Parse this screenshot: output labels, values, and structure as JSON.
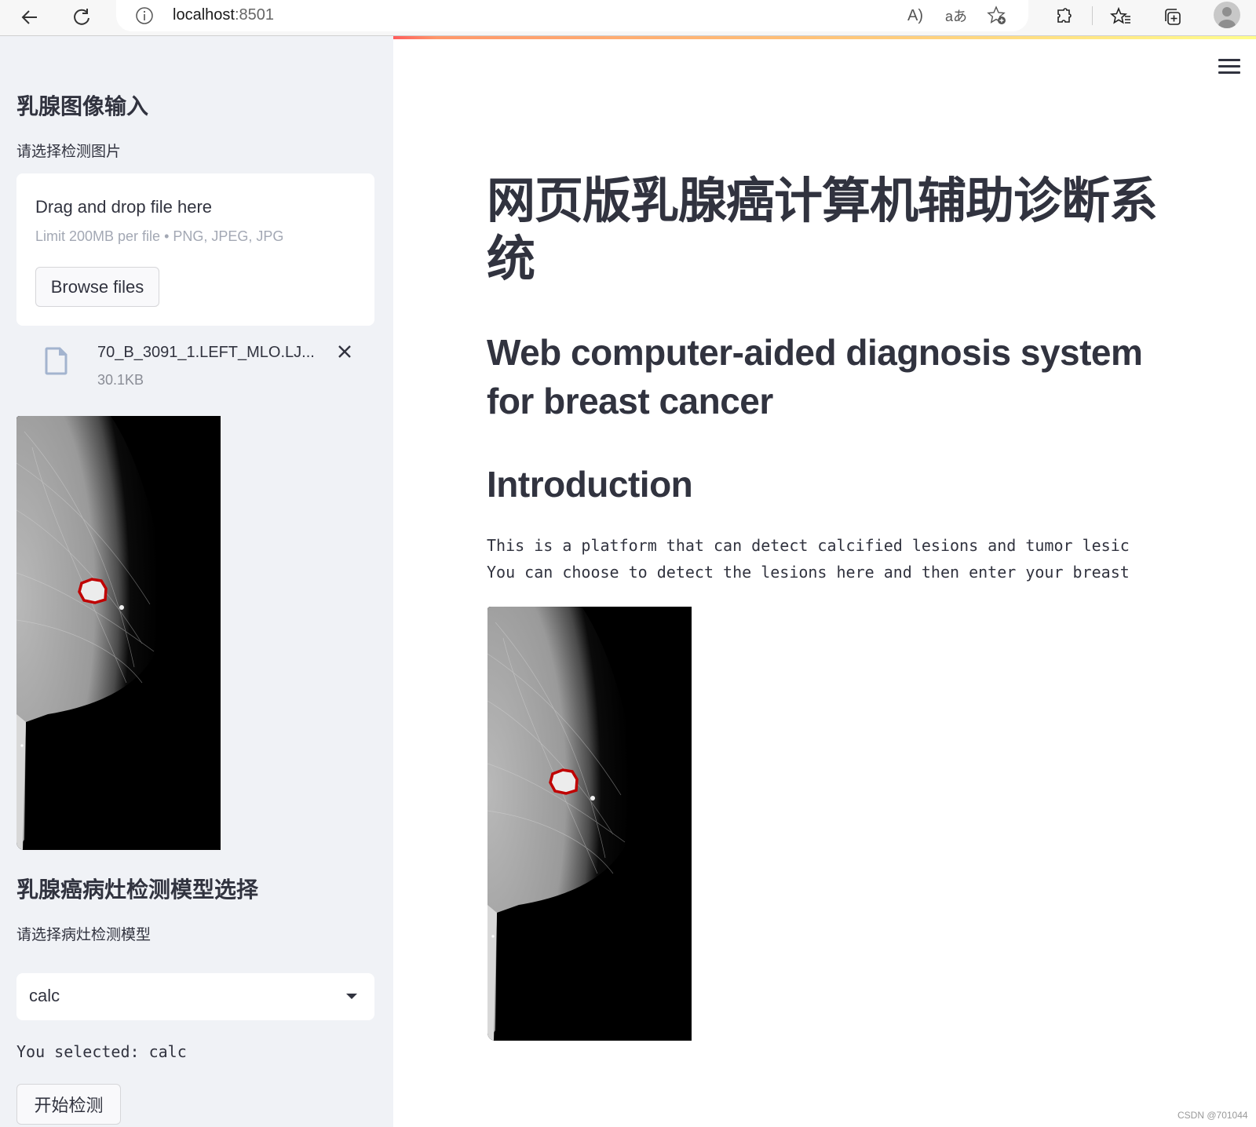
{
  "browser": {
    "address_host": "localhost",
    "address_port": ":8501",
    "icons": [
      "back-arrow-icon",
      "reload-icon",
      "site-info-icon",
      "read-aloud-icon",
      "translate-icon",
      "add-favorite-icon",
      "extensions-icon",
      "favorites-icon",
      "collections-icon",
      "profile-avatar-icon"
    ]
  },
  "sidebar": {
    "upload_section": {
      "heading": "乳腺图像输入",
      "label": "请选择检测图片",
      "dropzone_title": "Drag and drop file here",
      "dropzone_subtitle": "Limit 200MB per file • PNG, JPEG, JPG",
      "browse_button": "Browse files",
      "uploaded_file": {
        "name": "70_B_3091_1.LEFT_MLO.LJ...",
        "size": "30.1KB"
      }
    },
    "model_section": {
      "heading": "乳腺癌病灶检测模型选择",
      "label": "请选择病灶检测模型",
      "selected_model": "calc",
      "selected_text": "You selected: calc",
      "start_button": "开始检测"
    }
  },
  "main": {
    "title_zh": "网页版乳腺癌计算机辅助诊断系统",
    "title_en": "Web computer-aided diagnosis system for breast cancer",
    "intro_heading": "Introduction",
    "intro_lines": [
      "This is a platform that can detect calcified lesions and tumor lesic",
      "You can choose to detect the lesions here and then enter your breast"
    ],
    "image_alt": "mammogram with detected lesion outline"
  },
  "colors": {
    "sidebar_bg": "#f0f2f6",
    "text": "#31333f",
    "lesion_outline": "#c00000"
  },
  "watermark": "CSDN @701044"
}
